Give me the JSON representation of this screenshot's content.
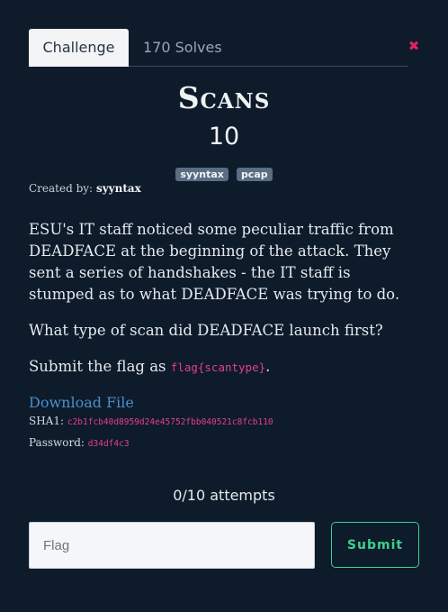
{
  "tabs": {
    "challenge": "Challenge",
    "solves": "170 Solves"
  },
  "close_icon": "close-icon",
  "challenge": {
    "name": "Scans",
    "points": "10",
    "tags": [
      "syyntax",
      "pcap"
    ],
    "author_label": "Created by:",
    "author": "syyntax",
    "description": {
      "p1": "ESU's IT staff noticed some peculiar traffic from DEADFACE at the beginning of the attack. They sent a series of handshakes - the IT staff is stumped as to what DEADFACE was trying to do.",
      "p2": "What type of scan did DEADFACE launch first?",
      "p3_prefix": "Submit the flag as ",
      "p3_code": "flag{scantype}",
      "p3_suffix": "."
    },
    "download_label": "Download File",
    "sha1_label": "SHA1:",
    "sha1": "c2b1fcb40d8959d24e45752fbb040521c8fcb110",
    "password_label": "Password:",
    "password": "d34df4c3"
  },
  "attempts": "0/10 attempts",
  "form": {
    "placeholder": "Flag",
    "value": "",
    "submit_label": "Submit"
  },
  "colors": {
    "background": "#0d1b2a",
    "accent": "#3ecf8e",
    "link": "#4a8fc9",
    "code": "#e83e8c",
    "close": "#e0245e"
  }
}
